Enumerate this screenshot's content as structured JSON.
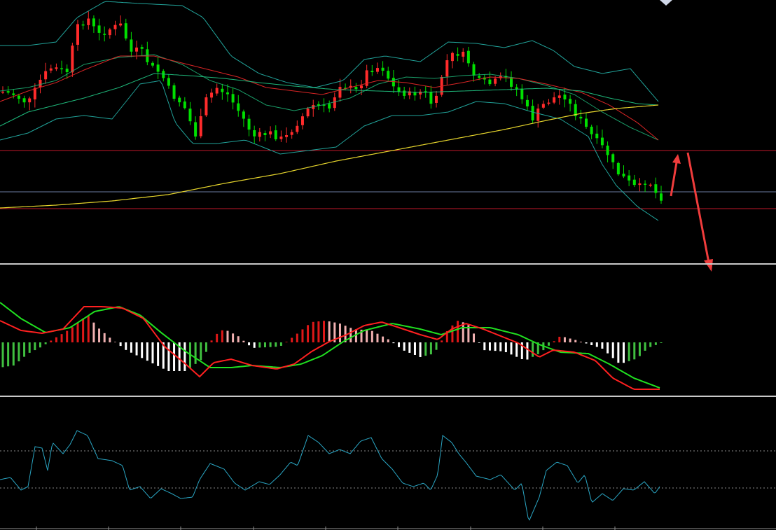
{
  "chart_data": [
    {
      "type": "candlestick",
      "panel": "price",
      "overlays": [
        "bollinger_bands",
        "moving_average_short",
        "moving_average_mid",
        "moving_average_long"
      ],
      "horizontal_levels": [
        "resistance",
        "reference",
        "support"
      ],
      "annotations": [
        "up-arrow",
        "down-arrow"
      ],
      "colors": {
        "up": "#ff2b2b",
        "down": "#00e000",
        "boll": "#21a39a",
        "ma_short": "#d92525",
        "ma_mid": "#1eb87a",
        "ma_long": "#e6d52c",
        "level_red": "#c0182a",
        "level_ref": "#6a7aa0",
        "arrow": "#f03c3c"
      }
    },
    {
      "type": "macd",
      "panel": "indicator",
      "series": [
        {
          "role": "dif",
          "color": "#ff2020"
        },
        {
          "role": "dea",
          "color": "#20e020"
        }
      ],
      "histogram_colors": {
        "pos_rising": "#e01818",
        "pos_falling": "#f0b0b0",
        "neg_falling": "#ffffff",
        "neg_rising": "#40c040"
      }
    },
    {
      "type": "line",
      "panel": "oscillator",
      "reference_lines": 2,
      "color": "#2aa6c4"
    }
  ]
}
